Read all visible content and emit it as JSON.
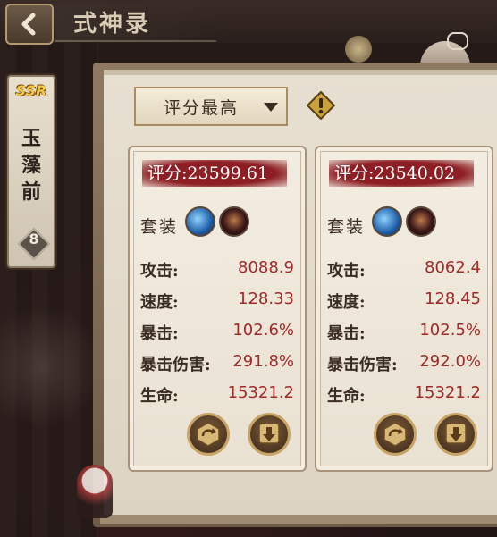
{
  "header": {
    "title": "式神录",
    "back_icon": "chevron-left-icon"
  },
  "character": {
    "rarity": "SSR",
    "name_chars": [
      "玉",
      "藻",
      "前"
    ],
    "level": "8"
  },
  "sort": {
    "selected": "评分最高",
    "arrow_icon": "triangle-down-icon"
  },
  "info_icon": "exclamation-diamond-icon",
  "cards": [
    {
      "score": "评分:23599.61",
      "set_label": "套装",
      "stats": [
        {
          "label": "攻击:",
          "value": "8088.9"
        },
        {
          "label": "速度:",
          "value": "128.33"
        },
        {
          "label": "暴击:",
          "value": "102.6%"
        },
        {
          "label": "暴击伤害:",
          "value": "291.8%"
        },
        {
          "label": "生命:",
          "value": "15321.2"
        }
      ]
    },
    {
      "score": "评分:23540.02",
      "set_label": "套装",
      "stats": [
        {
          "label": "攻击:",
          "value": "8062.4"
        },
        {
          "label": "速度:",
          "value": "128.45"
        },
        {
          "label": "暴击:",
          "value": "102.5%"
        },
        {
          "label": "暴击伤害:",
          "value": "292.0%"
        },
        {
          "label": "生命:",
          "value": "15321.2"
        }
      ]
    }
  ],
  "colors": {
    "score_bg": "#8d1f24",
    "stat_value": "#a02a28",
    "panel_bg": "#e7dfd1"
  }
}
